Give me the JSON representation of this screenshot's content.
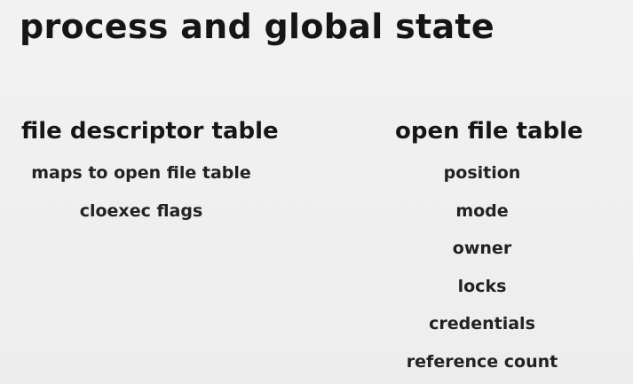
{
  "slide": {
    "title": "process and global state",
    "left_column": {
      "heading": "file descriptor table",
      "items": [
        "maps to open file table",
        "cloexec flags"
      ]
    },
    "right_column": {
      "heading": "open file table",
      "items": [
        "position",
        "mode",
        "owner",
        "locks",
        "credentials",
        "reference count"
      ]
    }
  }
}
